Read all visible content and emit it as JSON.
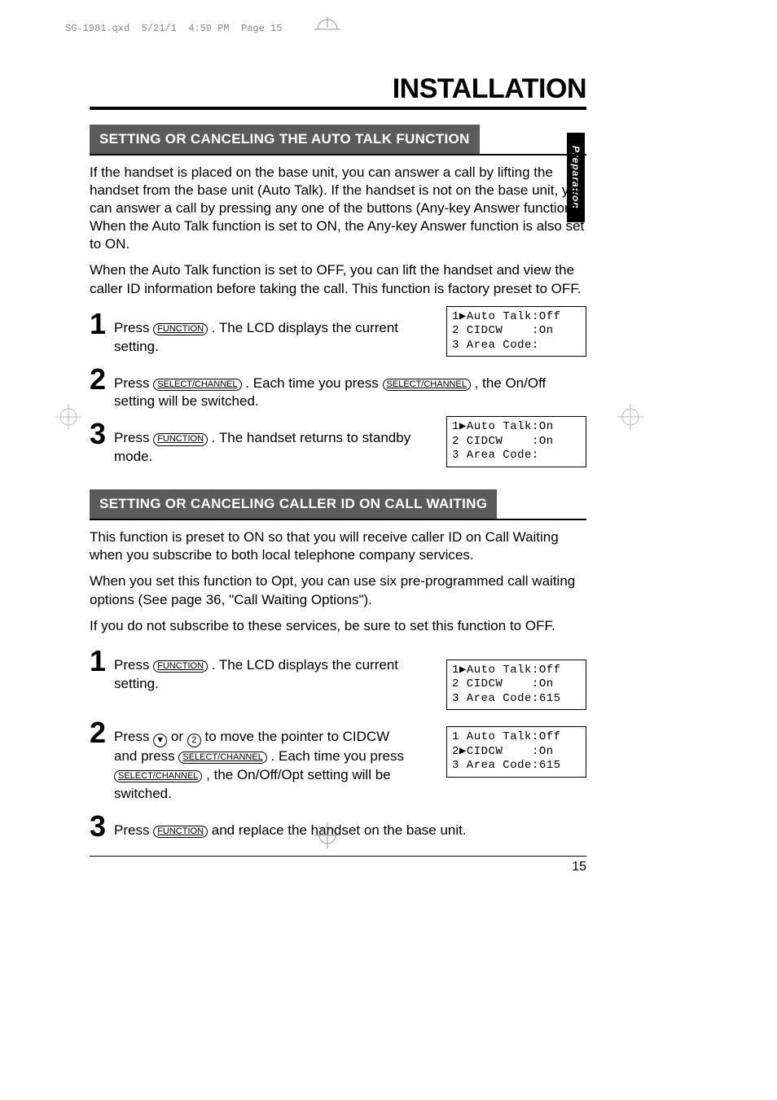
{
  "header": "SG-1981.qxd  5/21/1  4:59 PM  Page 15",
  "title": "INSTALLATION",
  "sidebar": "Preparation",
  "page_number": "15",
  "section1": {
    "banner": "SETTING OR CANCELING THE AUTO TALK FUNCTION",
    "p1": "If the handset is placed on the base unit, you can answer a call by lifting the handset from the base unit (Auto Talk).  If the handset is not on the base unit, you can answer a call by pressing any one of the buttons (Any-key Answer function). When the Auto Talk function is set to ON, the Any-key Answer function is also set to ON.",
    "p2": "When the Auto Talk function is set to OFF, you can lift the handset and view the caller ID information before taking the call.  This function is factory preset to OFF.",
    "step1": {
      "num": "1",
      "pre": "Press ",
      "btn": "FUNCTION",
      "post": " .  The LCD displays the current setting."
    },
    "lcd1": "1▶Auto Talk:Off\n2 CIDCW    :On\n3 Area Code:",
    "step2": {
      "num": "2",
      "pre": "Press ",
      "btn1": "SELECT/CHANNEL",
      "mid": " . Each time you press ",
      "btn2": "SELECT/CHANNEL",
      "post": " , the On/Off setting will be switched."
    },
    "step3": {
      "num": "3",
      "pre": "Press ",
      "btn": "FUNCTION",
      "post": " .  The handset returns to standby mode."
    },
    "lcd3": "1▶Auto Talk:On\n2 CIDCW    :On\n3 Area Code:"
  },
  "section2": {
    "banner": "SETTING OR CANCELING CALLER ID ON CALL WAITING",
    "p1": "This function is preset to ON so that you will receive caller ID on Call Waiting when you subscribe to both local telephone company services.",
    "p2": "When you set this function to Opt, you can use six pre-programmed call waiting options (See page 36, \"Call Waiting Options\").",
    "p3": "If you do not subscribe to these services, be sure to set this function to OFF.",
    "step1": {
      "num": "1",
      "pre": "Press ",
      "btn": "FUNCTION",
      "post": " . The LCD displays the current setting."
    },
    "lcd1": "1▶Auto Talk:Off\n2 CIDCW    :On\n3 Area Code:615",
    "step2": {
      "num": "2",
      "pre": "Press ",
      "icon1": "▼",
      "mid1": " or ",
      "icon2": "2",
      "mid2": " to move the pointer to CIDCW and press ",
      "btn1": "SELECT/CHANNEL",
      "mid3": " .  Each time you press ",
      "btn2": "SELECT/CHANNEL",
      "post": " , the On/Off/Opt setting will be switched."
    },
    "lcd2": "1 Auto Talk:Off\n2▶CIDCW    :On\n3 Area Code:615",
    "step3": {
      "num": "3",
      "pre": "Press ",
      "btn": "FUNCTION",
      "post": "  and replace the handset on the base unit."
    }
  }
}
